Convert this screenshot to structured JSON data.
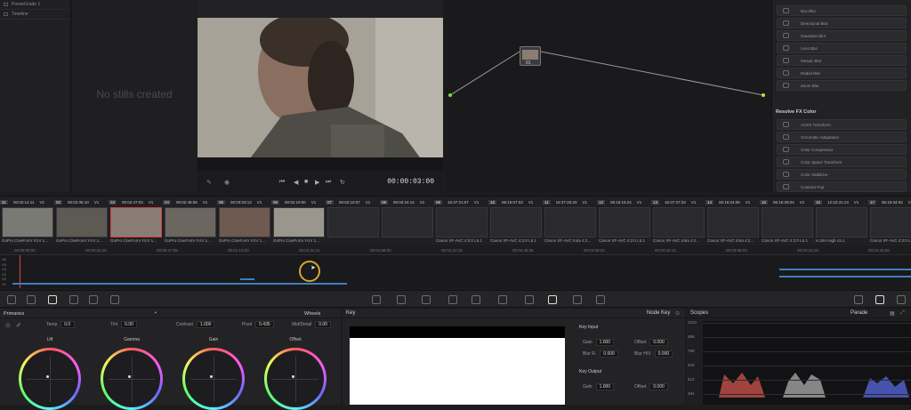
{
  "gallery": {
    "items": [
      "PowerGrade 1",
      "Timeline"
    ],
    "empty_text": "No stills created"
  },
  "viewer": {
    "timecode": "00:00:03:00"
  },
  "fx": {
    "items_top": [
      "Box Blur",
      "Directional Blur",
      "Gaussian Blur",
      "Lens Blur",
      "Mosaic Blur",
      "Radial Blur",
      "Zoom Blur"
    ],
    "section": "Resolve FX Color",
    "items_color": [
      "ACES Transform",
      "Chromatic Adaptation",
      "Color Compressor",
      "Color Space Transform",
      "Color Stabilizer",
      "Contrast Pop"
    ]
  },
  "node": {
    "label": "01"
  },
  "clips": [
    {
      "num": "01",
      "tc": "00:02:14:11",
      "v": "V1",
      "name": "GoPro CineForm YUV 1..."
    },
    {
      "num": "02",
      "tc": "00:02:36:10",
      "v": "V1",
      "name": "GoPro CineForm YUV 1..."
    },
    {
      "num": "03",
      "tc": "00:02:47:03",
      "v": "V1",
      "name": "GoPro CineForm YUV 1..."
    },
    {
      "num": "04",
      "tc": "00:02:48:08",
      "v": "V1",
      "name": "GoPro CineForm YUV 1..."
    },
    {
      "num": "05",
      "tc": "00:03:03:13",
      "v": "V1",
      "name": "GoPro CineForm YUV 1..."
    },
    {
      "num": "06",
      "tc": "00:02:19:00",
      "v": "V1",
      "name": "GoPro CineForm YUV 1..."
    },
    {
      "num": "07",
      "tc": "00:02:10:07",
      "v": "V1",
      "name": ""
    },
    {
      "num": "08",
      "tc": "00:02:24:14",
      "v": "V1",
      "name": ""
    },
    {
      "num": "09",
      "tc": "15:37:21:07",
      "v": "V1",
      "name": "Canon XF-AVC 4:2:0 L5.1"
    },
    {
      "num": "10",
      "tc": "06:15:07:03",
      "v": "V1",
      "name": "Canon XF-AVC 4:2:0 L5.1"
    },
    {
      "num": "11",
      "tc": "15:37:25:20",
      "v": "V1",
      "name": "Canon XF-AVC Intra 4:2..."
    },
    {
      "num": "12",
      "tc": "06:15:16:24",
      "v": "V1",
      "name": "Canon XF-AVC 4:2:0 L5.1"
    },
    {
      "num": "13",
      "tc": "15:37:37:23",
      "v": "V1",
      "name": "Canon XF-AVC Intra 4:2..."
    },
    {
      "num": "14",
      "tc": "06:15:24:06",
      "v": "V1",
      "name": "Canon XF-AVC Intra 4:2..."
    },
    {
      "num": "15",
      "tc": "06:16:29:04",
      "v": "V1",
      "name": "Canon XF-AVC 4:2:0 L5.1"
    },
    {
      "num": "16",
      "tc": "12:22:31:13",
      "v": "V1",
      "name": "H.264 High L5.1"
    },
    {
      "num": "17",
      "tc": "06:16:34:04",
      "v": "V1",
      "name": "Canon XF-AVC 4:2:0 L5.1"
    }
  ],
  "ruler": [
    "00:00:00:00",
    "00:00:23:15",
    "00:00:47:05",
    "00:01:10:20",
    "00:01:34:11",
    "00:01:58:02",
    "00:02:21:16",
    "00:02:45:06",
    "00:03:08:22",
    "00:03:32:13",
    "00:03:56:03",
    "00:04:19:18",
    "00:04:43:08"
  ],
  "tracks": [
    "V6",
    "V5",
    "V4",
    "V3",
    "V2",
    "V1"
  ],
  "primaries": {
    "title": "Primaries",
    "mode": "Wheels",
    "params": [
      {
        "label": "Temp",
        "value": "0.0"
      },
      {
        "label": "Tint",
        "value": "0.00"
      },
      {
        "label": "Contrast",
        "value": "1.000"
      },
      {
        "label": "Pivot",
        "value": "0.435"
      },
      {
        "label": "Mid/Detail",
        "value": "0.00"
      }
    ],
    "wheels": [
      "Lift",
      "Gamma",
      "Gain",
      "Offset"
    ]
  },
  "key": {
    "title": "Key",
    "mode": "Node Key",
    "input_title": "Key Input",
    "output_title": "Key Output",
    "input": [
      {
        "label": "Gain",
        "value": "1.000"
      },
      {
        "label": "Offset",
        "value": "0.000"
      },
      {
        "label": "Blur R.",
        "value": "0.000"
      },
      {
        "label": "Blur H/V",
        "value": "0.000"
      }
    ],
    "output": [
      {
        "label": "Gain",
        "value": "1.000"
      },
      {
        "label": "Offset",
        "value": "0.000"
      }
    ]
  },
  "scopes": {
    "title": "Scopes",
    "mode": "Parade",
    "levels": [
      "1023",
      "896",
      "768",
      "640",
      "512",
      "384"
    ]
  }
}
